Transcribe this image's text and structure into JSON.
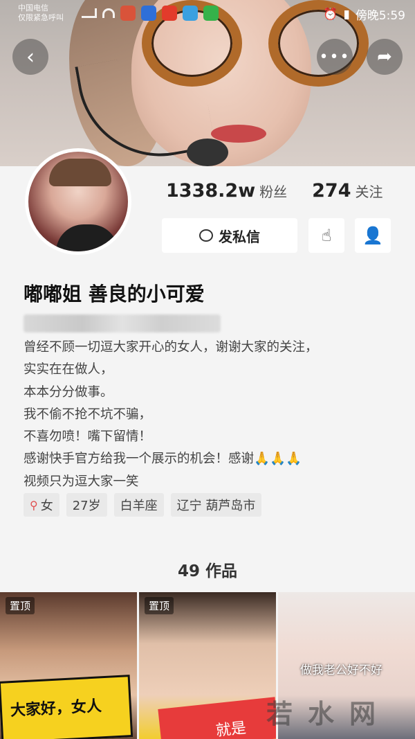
{
  "status_bar": {
    "carrier_line1": "中国电信",
    "carrier_line2": "仅限紧急呼叫",
    "time": "傍晚5:59"
  },
  "colors": {
    "accent_female": "#e05050",
    "yellow_card": "#f6d11f",
    "red_card": "#e73b3b"
  },
  "icons": {
    "back": "chevron-left-icon",
    "more": "more-icon",
    "share": "share-icon"
  },
  "profile": {
    "followers_count": "1338.2w",
    "followers_label": "粉丝",
    "following_count": "274",
    "following_label": "关注",
    "message_button": "发私信",
    "name": "嘟嘟姐  善良的小可爱",
    "bio": [
      "曾经不顾一切逗大家开心的女人，谢谢大家的关注，",
      "实实在在做人，",
      "本本分分做事。",
      "我不偷不抢不坑不骗，",
      "不喜勿喷！嘴下留情！",
      "感谢快手官方给我一个展示的机会！感谢🙏🙏🙏",
      "视频只为逗大家一笑"
    ],
    "tags": {
      "gender": "女",
      "age": "27岁",
      "zodiac": "白羊座",
      "location": "辽宁 葫芦岛市"
    }
  },
  "works": {
    "count_label": "49 作品",
    "items": [
      {
        "pin": "置顶",
        "caption": "大家好，女人"
      },
      {
        "pin": "置顶",
        "caption": "就是"
      },
      {
        "caption": "做我老公好不好"
      }
    ]
  },
  "watermark": "若水网"
}
